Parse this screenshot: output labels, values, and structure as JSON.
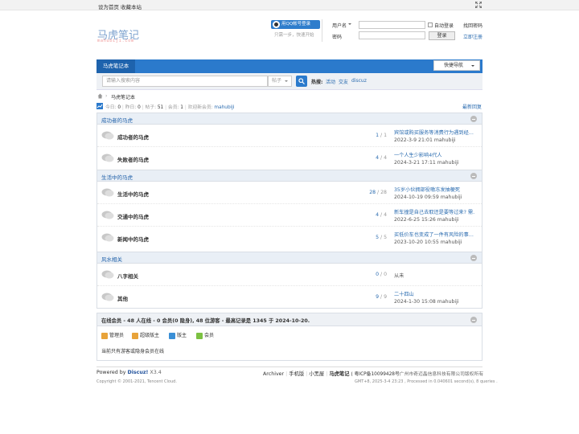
{
  "topbar": {
    "set_home": "设为首页",
    "bookmark": "收藏本站"
  },
  "header": {
    "logo_text": "马虎笔记",
    "logo_sub": "mahubiji.com",
    "qq_login": "用QQ帐号登录",
    "qq_note": "只需一步，快速开始",
    "username_label": "用户名",
    "password_label": "密码",
    "auto_login": "自动登录",
    "login_button": "登录",
    "find_password": "找回密码",
    "register": "立即注册"
  },
  "nav": {
    "tab": "马虎笔记本",
    "quick_nav": "快捷导航"
  },
  "search": {
    "placeholder": "请输入搜索内容",
    "type": "帖子",
    "hot_label": "热搜:",
    "hot": [
      "活动",
      "交友",
      "discuz"
    ]
  },
  "breadcrumb": {
    "current": "马虎笔记本"
  },
  "stats": {
    "today_label": "今日:",
    "today": "0",
    "yesterday_label": "昨日:",
    "yesterday": "0",
    "posts_label": "帖子:",
    "posts": "51",
    "members_label": "会员:",
    "members": "1",
    "newest_label": "欢迎新会员:",
    "newest": "mahubiji",
    "latest_reply": "最新回复"
  },
  "categories": [
    {
      "title": "成功者的马虎",
      "forums": [
        {
          "name": "成功者的马虎",
          "threads": "1",
          "posts": "1",
          "last_title": "宾馆或购买服务等消费行为遇到经…",
          "last_info": "2022-3-9 21:01 mahubiji"
        },
        {
          "name": "失败者的马虎",
          "threads": "4",
          "posts": "4",
          "last_title": "一个人生少影响4代人",
          "last_info": "2024-3-21 17:11 mahubiji"
        }
      ]
    },
    {
      "title": "生活中的马虎",
      "forums": [
        {
          "name": "生活中的马虎",
          "threads": "28",
          "posts": "28",
          "last_title": "35岁小伙拥部役嗷冻发抽梗死",
          "last_info": "2024-10-19 09:59 mahubiji"
        },
        {
          "name": "交通中的马虎",
          "threads": "4",
          "posts": "4",
          "last_title": "新车撞是自己去取还是要等过来? 需…",
          "last_info": "2022-6-25 15:26 mahubiji"
        },
        {
          "name": "新闻中的马虎",
          "threads": "5",
          "posts": "5",
          "last_title": "买低价车也变成了一件有风险的事…",
          "last_info": "2023-10-20 10:55 mahubiji"
        }
      ]
    },
    {
      "title": "风水相关",
      "forums": [
        {
          "name": "八字相关",
          "threads": "0",
          "posts": "0",
          "last_title": "",
          "last_info": "从未"
        },
        {
          "name": "其他",
          "threads": "9",
          "posts": "9",
          "last_title": "二十四山",
          "last_info": "2024-1-30 15:08 mahubiji"
        }
      ]
    }
  ],
  "online": {
    "summary": "在线会员 - 48 人在线 - 0 会员(0 隐身), 48 位游客 - 最高记录是 1345 于 2024-10-20.",
    "legend": [
      "管理员",
      "超级版主",
      "版主",
      "会员"
    ],
    "legend_colors": [
      "#e8a33a",
      "#e8a33a",
      "#3a8fd6",
      "#7cc142"
    ],
    "no_members": "当前只有游客或隐身会员在线"
  },
  "footer": {
    "powered": "Powered by",
    "brand": "Discuz!",
    "version": "X3.4",
    "links": [
      "Archiver",
      "手机版",
      "小黑屋"
    ],
    "site": "马虎笔记",
    "icp": "( 粤ICP备10099428号",
    "company": "广州市奇迈晶信息科技有限公司版权所有",
    "copyright": "Copyright © 2001-2021, Tencent Cloud.",
    "timing": "GMT+8, 2025-3-4 23:23 , Processed in 0.040601 second(s), 8 queries ."
  }
}
